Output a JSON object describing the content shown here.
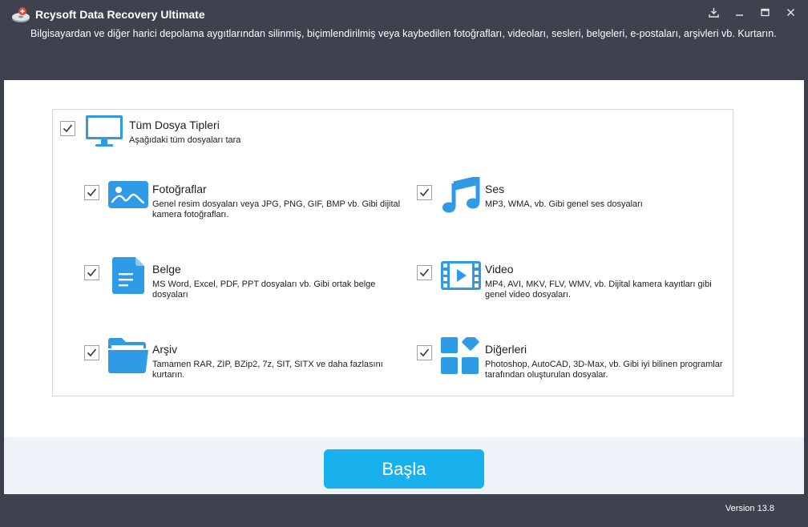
{
  "window": {
    "title": "Rcysoft Data Recovery Ultimate",
    "subtitle": "Bilgisayardan ve diğer harici depolama aygıtlarından silinmiş, biçimlendirilmiş veya kaybedilen fotoğrafları, videoları, sesleri, belgeleri, e-postaları, arşivleri vb. Kurtarın."
  },
  "all_types": {
    "title": "Tüm Dosya Tipleri",
    "desc": "Aşağıdaki tüm dosyaları tara",
    "checked": true,
    "icon": "monitor-icon"
  },
  "categories": [
    {
      "title": "Fotoğraflar",
      "desc": "Genel resim dosyaları veya JPG, PNG, GIF, BMP vb. Gibi dijital kamera fotoğrafları.",
      "checked": true,
      "icon": "photo-icon"
    },
    {
      "title": "Ses",
      "desc": "MP3, WMA, vb. Gibi genel ses dosyaları",
      "checked": true,
      "icon": "music-note-icon"
    },
    {
      "title": "Belge",
      "desc": "MS Word, Excel, PDF, PPT dosyaları vb. Gibi ortak belge dosyaları",
      "checked": true,
      "icon": "document-icon"
    },
    {
      "title": "Video",
      "desc": "MP4, AVI, MKV, FLV, WMV, vb. Dijital kamera kayıtları gibi genel video dosyaları.",
      "checked": true,
      "icon": "video-film-icon"
    },
    {
      "title": "Arşiv",
      "desc": "Tamamen RAR, ZIP, BZip2, 7z, SIT, SITX ve daha fazlasını kurtarın.",
      "checked": true,
      "icon": "folder-icon"
    },
    {
      "title": "Diğerleri",
      "desc": "Photoshop, AutoCAD, 3D-Max, vb. Gibi iyi bilinen programlar tarafından oluşturulan dosyalar.",
      "checked": true,
      "icon": "tiles-icon"
    }
  ],
  "start_button": "Başla",
  "version": "Version 13.8",
  "colors": {
    "accent": "#19b0ee",
    "icon_blue": "#2f9ae6",
    "header": "#3d424e"
  }
}
